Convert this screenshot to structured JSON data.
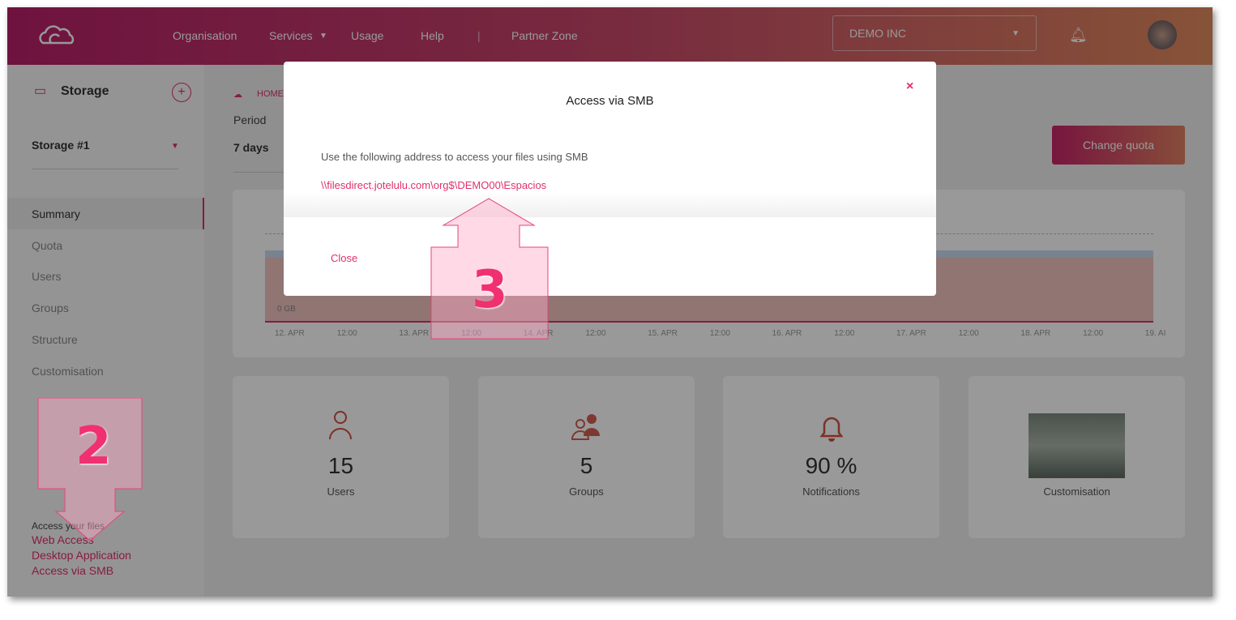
{
  "header": {
    "logo": "cloud-logo",
    "nav": [
      "Organisation",
      "Services",
      "Usage",
      "Help",
      "Partner Zone"
    ],
    "org_select": "DEMO INC"
  },
  "sidebar": {
    "title": "Storage",
    "storage_select": "Storage #1",
    "items": [
      "Summary",
      "Quota",
      "Users",
      "Groups",
      "Structure",
      "Customisation"
    ],
    "access_title": "Access your files",
    "access_links": [
      "Web Access",
      "Desktop Application",
      "Access via SMB"
    ]
  },
  "main": {
    "breadcrumb": "HOME",
    "period_label": "Period",
    "period_value": "7 days",
    "change_quota": "Change quota"
  },
  "chart_data": {
    "type": "area",
    "y_ticks": [
      "0 GB"
    ],
    "x_ticks": [
      "12. APR",
      "12:00",
      "13. APR",
      "12:00",
      "14. APR",
      "12:00",
      "15. APR",
      "12:00",
      "16. APR",
      "12:00",
      "17. APR",
      "12:00",
      "18. APR",
      "12:00",
      "19. AI"
    ],
    "series_colors": [
      "#e88a8a",
      "#9ec3e6"
    ]
  },
  "stats": [
    {
      "value": "15",
      "label": "Users",
      "icon": "user-icon"
    },
    {
      "value": "5",
      "label": "Groups",
      "icon": "groups-icon"
    },
    {
      "value": "90 %",
      "label": "Notifications",
      "icon": "bell-icon"
    },
    {
      "value": "",
      "label": "Customisation",
      "icon": "image-thumbnail"
    }
  ],
  "modal": {
    "title": "Access via SMB",
    "text": "Use the following address to access your files using SMB",
    "address": "\\\\filesdirect.jotelulu.com\\org$\\DEMO00\\Espacios",
    "close": "Close"
  },
  "annotations": [
    "2",
    "3"
  ],
  "colors": {
    "accent": "#e0306a",
    "header_start": "#b8206a",
    "header_end": "#e08a5e"
  }
}
